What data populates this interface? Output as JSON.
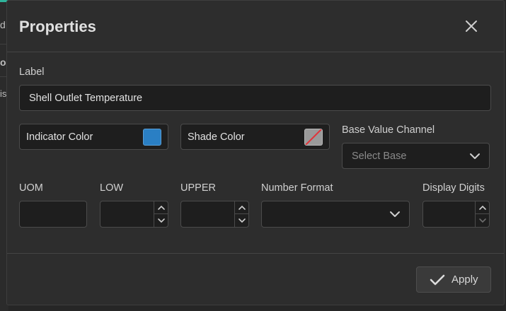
{
  "background": {
    "fragment_1": "d",
    "fragment_2": "o",
    "fragment_3": "is",
    "accent_color": "#2fb39a"
  },
  "dialog": {
    "title": "Properties",
    "close_icon": "close-icon"
  },
  "fields": {
    "label": {
      "label": "Label",
      "value": "Shell Outlet Temperature"
    },
    "indicator_color": {
      "label": "Indicator Color",
      "color": "#2a7fc4"
    },
    "shade_color": {
      "label": "Shade Color",
      "color": "none",
      "icon": "no-color-icon"
    },
    "base_value_channel": {
      "label": "Base Value Channel",
      "placeholder": "Select Base"
    },
    "uom": {
      "label": "UOM",
      "value": ""
    },
    "low": {
      "label": "LOW",
      "value": ""
    },
    "upper": {
      "label": "UPPER",
      "value": ""
    },
    "number_format": {
      "label": "Number Format",
      "value": ""
    },
    "display_digits": {
      "label": "Display Digits",
      "value": ""
    }
  },
  "footer": {
    "apply_label": "Apply"
  }
}
